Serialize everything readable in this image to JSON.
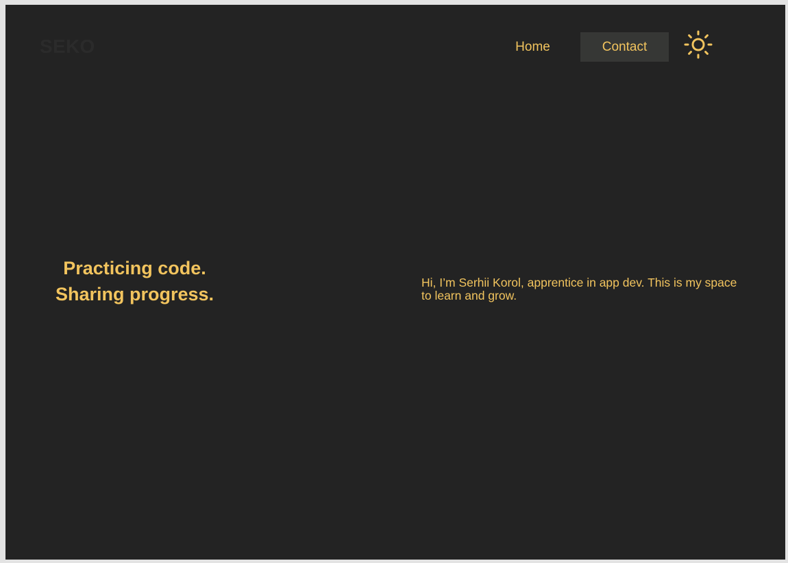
{
  "header": {
    "logo": "SEKO",
    "nav": {
      "home": "Home",
      "contact": "Contact"
    },
    "theme_toggle_icon": "sun-icon"
  },
  "hero": {
    "title_line1": "Practicing code.",
    "title_line2": "Sharing progress.",
    "intro": "Hi, I’m Serhii Korol, apprentice in app dev. This is my space to learn and grow."
  },
  "colors": {
    "background": "#232323",
    "accent": "#f2c45e",
    "active_nav_bg": "#363735",
    "logo": "#2b2b2b"
  }
}
